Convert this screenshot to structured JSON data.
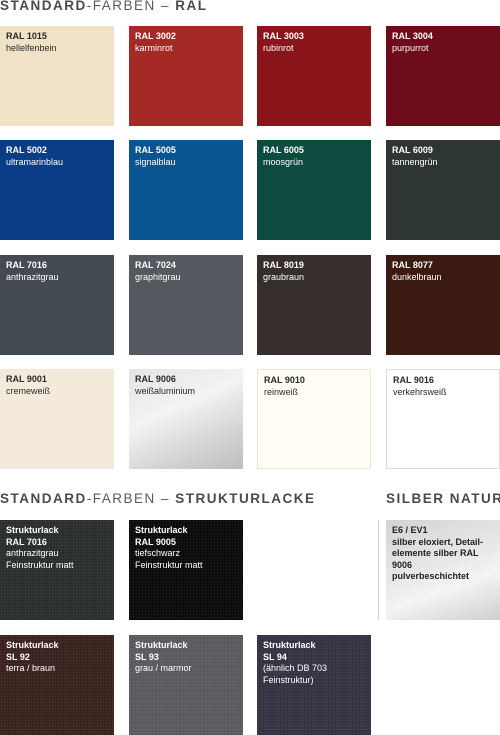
{
  "ral_heading": {
    "part1": "STANDARD",
    "part2": "-FARBEN – ",
    "part3": "RAL"
  },
  "ral_swatches": [
    {
      "code": "RAL 1015",
      "name": "hellelfenbein",
      "color": "#efe2c7",
      "text": "dark"
    },
    {
      "code": "RAL 3002",
      "name": "karminrot",
      "color": "#a52a26",
      "text": "light"
    },
    {
      "code": "RAL 3003",
      "name": "rubinrot",
      "color": "#8a1419",
      "text": "light"
    },
    {
      "code": "RAL 3004",
      "name": "purpurrot",
      "color": "#6e0c1c",
      "text": "light"
    },
    {
      "code": "RAL 5002",
      "name": "ultramarinblau",
      "color": "#0b3d86",
      "text": "light"
    },
    {
      "code": "RAL 5005",
      "name": "signalblau",
      "color": "#0a5491",
      "text": "light"
    },
    {
      "code": "RAL 6005",
      "name": "moosgrün",
      "color": "#0d4b3f",
      "text": "light"
    },
    {
      "code": "RAL 6009",
      "name": "tannengrün",
      "color": "#2e3633",
      "text": "light"
    },
    {
      "code": "RAL 7016",
      "name": "anthrazitgrau",
      "color": "#434a52",
      "text": "light"
    },
    {
      "code": "RAL 7024",
      "name": "graphitgrau",
      "color": "#55585f",
      "text": "light"
    },
    {
      "code": "RAL 8019",
      "name": "graubraun",
      "color": "#362f2c",
      "text": "light"
    },
    {
      "code": "RAL 8077",
      "name": "dunkelbraun",
      "color": "#3b1a11",
      "text": "light"
    },
    {
      "code": "RAL 9001",
      "name": "cremeweiß",
      "color": "#f4eadc",
      "text": "dark"
    },
    {
      "code": "RAL 9006",
      "name": "weißaluminium",
      "color": "silver",
      "text": "dark"
    },
    {
      "code": "RAL 9010",
      "name": "reinweiß",
      "color": "#fffdf4",
      "text": "dark"
    },
    {
      "code": "RAL 9016",
      "name": "verkehrsweiß",
      "color": "#ffffff",
      "text": "dark"
    }
  ],
  "struct_heading": {
    "part1": "STANDARD",
    "part2": "-FARBEN – ",
    "part3": "STRUKTURLACKE"
  },
  "silver_heading": "SILBER NATUR",
  "struct_swatches": [
    {
      "lines": [
        "Strukturlack",
        "RAL 7016"
      ],
      "details": [
        "anthrazitgrau",
        "Feinstruktur matt"
      ],
      "color": "#2c302d"
    },
    {
      "lines": [
        "Strukturlack",
        "RAL 9005"
      ],
      "details": [
        "tiefschwarz",
        "Feinstruktur matt"
      ],
      "color": "#0c0c0d"
    },
    {
      "lines": [
        "Strukturlack",
        "SL 92"
      ],
      "details": [
        "terra / braun"
      ],
      "color": "#3d2320"
    },
    {
      "lines": [
        "Strukturlack",
        "SL 93"
      ],
      "details": [
        "grau / marmor"
      ],
      "color": "#5d5b61"
    },
    {
      "lines": [
        "Strukturlack",
        "SL 94"
      ],
      "details": [
        "(ähnlich DB 703",
        "Feinstruktur)"
      ],
      "color": "#363444"
    }
  ],
  "silver_box": {
    "lines": [
      "E6 / EV1",
      "silber eloxiert, Detail-",
      "elemente silber RAL 9006",
      "pulverbeschichtet"
    ]
  }
}
